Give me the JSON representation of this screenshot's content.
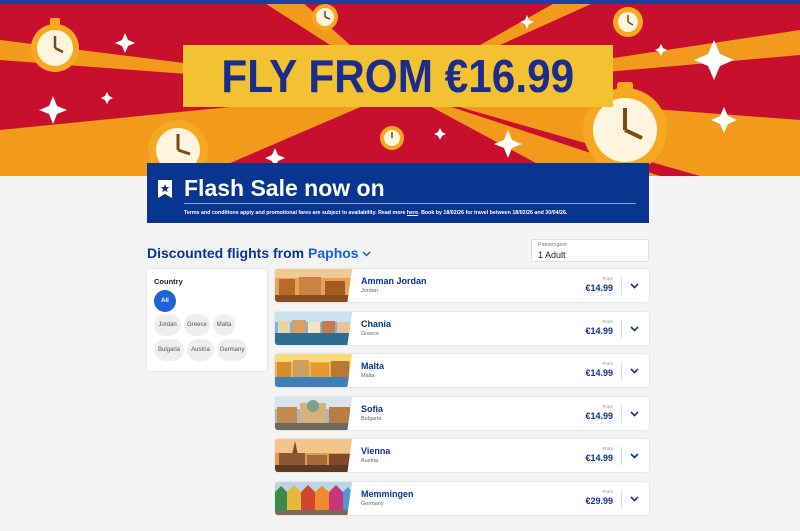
{
  "hero": {
    "headline": "FLY FROM €16.99",
    "colors": {
      "background": "#c8102e",
      "ray": "#f5a21b",
      "headline_box": "#f2c233",
      "headline_text": "#1b2c8c"
    }
  },
  "banner": {
    "title": "Flash Sale now on",
    "terms_before": "Terms and conditions apply and promotional fares are subject to availability. Read more ",
    "terms_link": "here",
    "terms_after": ". Book by 18/02/26 for travel between 18/02/26 and 30/04/26.",
    "icon": "star-badge-icon",
    "color": "#073590"
  },
  "section": {
    "title_prefix": "Discounted flights from",
    "origin": "Paphos"
  },
  "passengers": {
    "label": "Passengers",
    "value": "1 Adult"
  },
  "filter": {
    "title": "Country",
    "chips": [
      "All",
      "Jordan",
      "Greece",
      "Malta",
      "Bulgaria",
      "Austria",
      "Germany"
    ],
    "selected": "All"
  },
  "destinations": [
    {
      "city": "Amman Jordan",
      "country": "Jordan",
      "from_label": "From",
      "price": "€14.99"
    },
    {
      "city": "Chania",
      "country": "Greece",
      "from_label": "From",
      "price": "€14.99"
    },
    {
      "city": "Malta",
      "country": "Malta",
      "from_label": "From",
      "price": "€14.99"
    },
    {
      "city": "Sofia",
      "country": "Bulgaria",
      "from_label": "From",
      "price": "€14.99"
    },
    {
      "city": "Vienna",
      "country": "Austria",
      "from_label": "From",
      "price": "€14.99"
    },
    {
      "city": "Memmingen",
      "country": "Germany",
      "from_label": "From",
      "price": "€29.99"
    }
  ]
}
